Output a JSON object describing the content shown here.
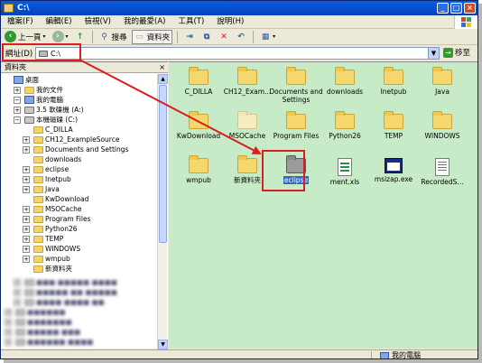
{
  "window": {
    "title": "C:\\"
  },
  "menu": [
    "檔案(F)",
    "編輯(E)",
    "檢視(V)",
    "我的最愛(A)",
    "工具(T)",
    "說明(H)"
  ],
  "toolbar": {
    "back": "上一頁",
    "search": "搜尋",
    "folders": "資料夾"
  },
  "address": {
    "label": "網址(D)",
    "value": "C:\\",
    "go": "移至"
  },
  "left_pane": {
    "header": "資料夾",
    "close": "×",
    "tree": [
      {
        "label": "桌面",
        "level": 0,
        "toggle": "",
        "icon": "desktop-icon"
      },
      {
        "label": "我的文件",
        "level": 1,
        "toggle": "+",
        "icon": "folder-icon"
      },
      {
        "label": "我的電腦",
        "level": 1,
        "toggle": "−",
        "icon": "computer-icon"
      },
      {
        "label": "3.5 軟碟機 (A:)",
        "level": 2,
        "toggle": "+",
        "icon": "floppy-icon"
      },
      {
        "label": "本機磁碟 (C:)",
        "level": 2,
        "toggle": "−",
        "icon": "drive-icon"
      },
      {
        "label": "C_DILLA",
        "level": 3,
        "toggle": "",
        "icon": "folder-icon"
      },
      {
        "label": "CH12_ExampleSource",
        "level": 3,
        "toggle": "+",
        "icon": "folder-icon"
      },
      {
        "label": "Documents and Settings",
        "level": 3,
        "toggle": "+",
        "icon": "folder-icon"
      },
      {
        "label": "downloads",
        "level": 3,
        "toggle": "",
        "icon": "folder-icon"
      },
      {
        "label": "eclipse",
        "level": 3,
        "toggle": "+",
        "icon": "folder-icon"
      },
      {
        "label": "Inetpub",
        "level": 3,
        "toggle": "+",
        "icon": "folder-icon"
      },
      {
        "label": "Java",
        "level": 3,
        "toggle": "+",
        "icon": "folder-icon"
      },
      {
        "label": "KwDownload",
        "level": 3,
        "toggle": "",
        "icon": "folder-icon"
      },
      {
        "label": "MSOCache",
        "level": 3,
        "toggle": "+",
        "icon": "folder-icon"
      },
      {
        "label": "Program Files",
        "level": 3,
        "toggle": "+",
        "icon": "folder-icon"
      },
      {
        "label": "Python26",
        "level": 3,
        "toggle": "+",
        "icon": "folder-icon"
      },
      {
        "label": "TEMP",
        "level": 3,
        "toggle": "+",
        "icon": "folder-icon"
      },
      {
        "label": "WINDOWS",
        "level": 3,
        "toggle": "+",
        "icon": "folder-icon"
      },
      {
        "label": "wmpub",
        "level": 3,
        "toggle": "+",
        "icon": "folder-icon"
      },
      {
        "label": "新資料夾",
        "level": 3,
        "toggle": "",
        "icon": "folder-icon"
      }
    ]
  },
  "right_pane": {
    "items": [
      {
        "name": "C_DILLA",
        "kind": "folder"
      },
      {
        "name": "CH12_Exam...",
        "kind": "folder"
      },
      {
        "name": "Documents and Settings",
        "kind": "folder"
      },
      {
        "name": "downloads",
        "kind": "folder"
      },
      {
        "name": "Inetpub",
        "kind": "folder"
      },
      {
        "name": "Java",
        "kind": "folder"
      },
      {
        "name": "KwDownload",
        "kind": "folder"
      },
      {
        "name": "MSOCache",
        "kind": "folder-dim"
      },
      {
        "name": "Program Files",
        "kind": "folder"
      },
      {
        "name": "Python26",
        "kind": "folder"
      },
      {
        "name": "TEMP",
        "kind": "folder"
      },
      {
        "name": "WINDOWS",
        "kind": "folder"
      },
      {
        "name": "wmpub",
        "kind": "folder"
      },
      {
        "name": "新資料夾",
        "kind": "folder"
      },
      {
        "name": "eclipse",
        "kind": "folder-selected"
      },
      {
        "name": "ment.xls",
        "kind": "xls"
      },
      {
        "name": "msizap.exe",
        "kind": "exe"
      },
      {
        "name": "RecordedS...",
        "kind": "doc"
      }
    ]
  },
  "status": {
    "location": "我的電腦"
  },
  "colors": {
    "highlight_red": "#d81e1e",
    "selection_blue": "#316ac5",
    "right_pane_bg": "#c7ebc7"
  }
}
